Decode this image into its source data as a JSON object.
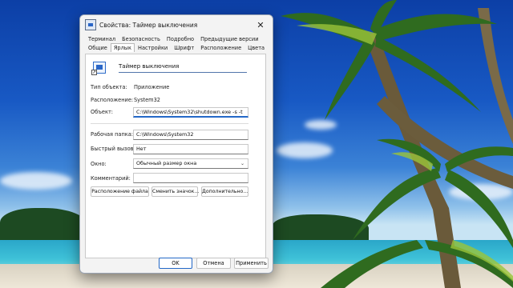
{
  "window": {
    "title": "Свойства: Таймер выключения",
    "close_glyph": "✕"
  },
  "tabs": {
    "back_row": [
      "Терминал",
      "Безопасность",
      "Подробно",
      "Предыдущие версии"
    ],
    "front_row": [
      "Общие",
      "Ярлык",
      "Настройки",
      "Шрифт",
      "Расположение",
      "Цвета"
    ],
    "active": "Ярлык"
  },
  "shortcut": {
    "name": "Таймер выключения",
    "type_label": "Тип объекта:",
    "type_value": "Приложение",
    "location_label": "Расположение:",
    "location_value": "System32",
    "target_label": "Объект:",
    "target_value": "C:\\Windows\\System32\\shutdown.exe -s -t",
    "start_in_label": "Рабочая папка:",
    "start_in_value": "C:\\Windows\\System32",
    "hotkey_label": "Быстрый вызов:",
    "hotkey_value": "Нет",
    "run_label": "Окно:",
    "run_value": "Обычный размер окна",
    "comment_label": "Комментарий:",
    "comment_value": ""
  },
  "panel_buttons": {
    "open_location": "Расположение файла",
    "change_icon": "Сменить значок...",
    "advanced": "Дополнительно..."
  },
  "dialog_buttons": {
    "ok": "OK",
    "cancel": "Отмена",
    "apply": "Применить"
  },
  "colors": {
    "accent": "#2468c7"
  },
  "icons": {
    "app": "shortcut-app-icon",
    "title": "window-app-icon",
    "close": "close-icon",
    "dropdown": "chevron-down-icon"
  }
}
